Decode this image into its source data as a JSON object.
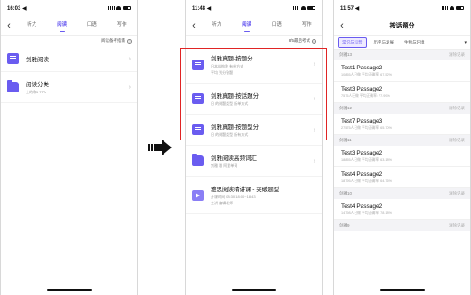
{
  "phone1": {
    "status_time": "16:03 ◀",
    "tabs": [
      "听力",
      "阅读",
      "口语",
      "写作"
    ],
    "active_tab": 1,
    "tip": "阅读备考指南",
    "items": [
      {
        "title": "剑雅阅读",
        "sub": ""
      },
      {
        "title": "阅读分类",
        "sub": "土的和5 TPA"
      }
    ]
  },
  "phone2": {
    "status_time": "11:48 ◀",
    "tabs": [
      "听力",
      "阅读",
      "口语",
      "写作"
    ],
    "active_tab": 1,
    "tip": "8/5最后考试",
    "items": [
      {
        "title": "剑雅真题-按题分",
        "sub": "日本机构利 有单方式",
        "sub2": "平均 到分答题"
      },
      {
        "title": "剑雅真题-按話題分",
        "sub": "日 的剩题类型 所单方式",
        "sub2": ""
      },
      {
        "title": "剑雅真题-按题型分",
        "sub": "日 的剩题类型 所有方式",
        "sub2": ""
      },
      {
        "title": "剑雅阅读高频词汇",
        "sub": "剑雅 雅 阿里单词",
        "sub2": ""
      },
      {
        "title": "雅思阅读精讲课 - 突破题型",
        "sub": "开课时间 08:30 18:00~18:43",
        "sub2": "主讲 编辑老师"
      }
    ]
  },
  "phone3": {
    "status_time": "11:57 ◀",
    "title": "按话题分",
    "filters": [
      "常识与科普",
      "历史与发展",
      "生物与环境"
    ],
    "more": "▾",
    "groups": [
      {
        "name": "剑雅13",
        "rec": "清除记录",
        "rows": [
          {
            "title": "Test1 Passage2",
            "sub": "10855人已做 平均正确率: 67.52%"
          },
          {
            "title": "Test3 Passage2",
            "sub": "7575人已做 平均正确率: 77.99%"
          }
        ]
      },
      {
        "name": "剑雅12",
        "rec": "清除记录",
        "rows": [
          {
            "title": "Test7 Passage3",
            "sub": "27575人已做 平均正确率: 65.70%"
          }
        ]
      },
      {
        "name": "剑雅11",
        "rec": "清除记录",
        "rows": [
          {
            "title": "Test3 Passage2",
            "sub": "18855人已做 平均正确率: 63.18%"
          },
          {
            "title": "Test4 Passage2",
            "sub": "18795人已做 平均正确率: 64.76%"
          }
        ]
      },
      {
        "name": "剑雅10",
        "rec": "清除记录",
        "rows": [
          {
            "title": "Test4 Passage2",
            "sub": "14798人已做 平均正确率: 78.18%"
          }
        ]
      },
      {
        "name": "剑雅9",
        "rec": "清除记录",
        "rows": []
      }
    ]
  },
  "colors": {
    "accent": "#6a5cf0",
    "highlight": "#e02424"
  }
}
